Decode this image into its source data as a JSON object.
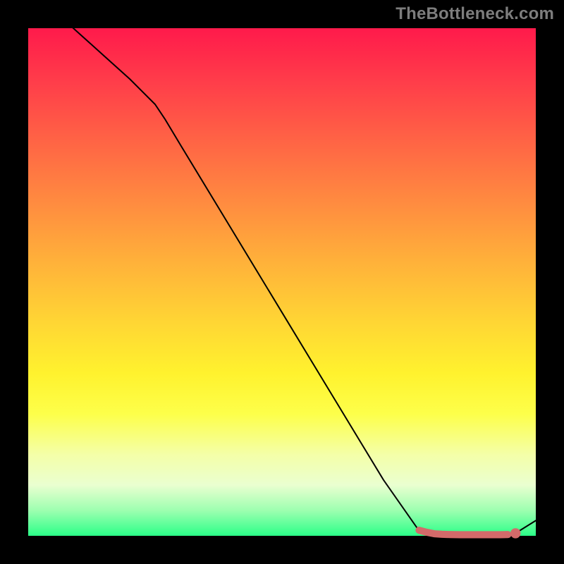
{
  "watermark": "TheBottleneck.com",
  "chart_data": {
    "type": "line",
    "title": "",
    "xlabel": "",
    "ylabel": "",
    "xlim": [
      0,
      100
    ],
    "ylim": [
      0,
      100
    ],
    "series": [
      {
        "name": "curve",
        "style": "solid-black",
        "x": [
          0,
          5,
          10,
          15,
          20,
          25,
          27,
          30,
          40,
          50,
          60,
          70,
          77,
          80,
          83,
          86,
          90,
          94,
          96,
          100
        ],
        "y": [
          108,
          103.5,
          99,
          94.5,
          90,
          85,
          82,
          77,
          60.5,
          44,
          27.5,
          11,
          1,
          0.3,
          0.2,
          0.2,
          0.2,
          0.2,
          0.5,
          3
        ]
      },
      {
        "name": "highlight",
        "style": "thick-pink",
        "x": [
          77,
          78.5,
          80,
          81.5,
          83,
          85,
          87,
          89,
          91,
          93,
          94.5
        ],
        "y": [
          1.1,
          0.7,
          0.4,
          0.3,
          0.25,
          0.22,
          0.22,
          0.22,
          0.22,
          0.22,
          0.25
        ]
      }
    ],
    "markers": [
      {
        "name": "end-dot",
        "x": 96,
        "y": 0.5,
        "r": 1.0,
        "color": "#d36a6a"
      }
    ]
  }
}
